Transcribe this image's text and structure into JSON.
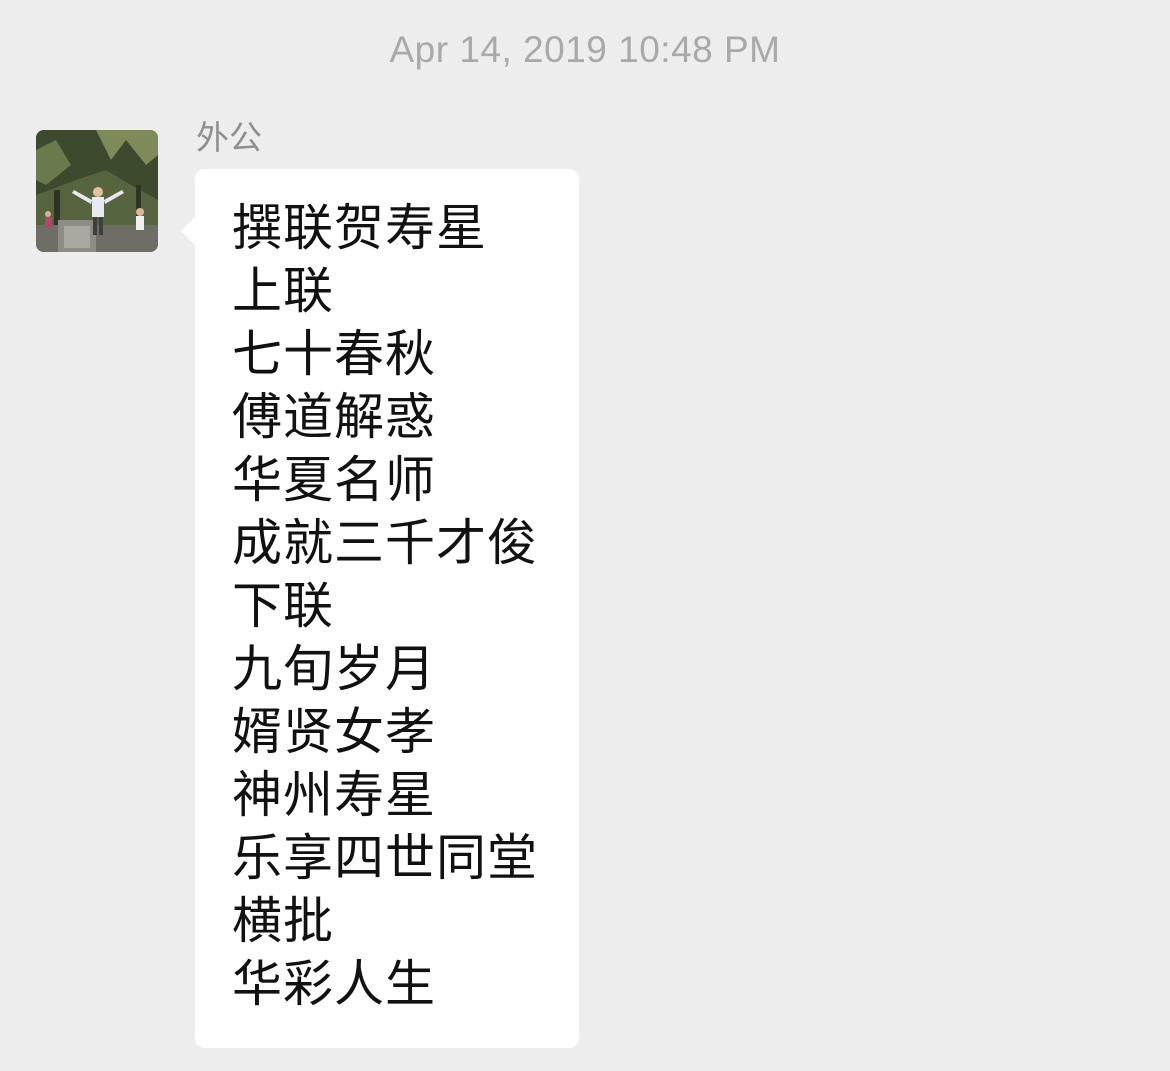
{
  "chat": {
    "timestamp": "Apr 14, 2019 10:48 PM",
    "sender_name": "外公",
    "avatar_icon": "contact-photo-icon",
    "message_lines": [
      "撰联贺寿星",
      "上联",
      "七十春秋",
      "傅道解惑",
      "华夏名师",
      "成就三千才俊",
      "下联",
      "九旬岁月",
      "婿贤女孝",
      "神州寿星",
      "乐享四世同堂",
      "横批",
      "华彩人生"
    ]
  },
  "colors": {
    "background": "#ededed",
    "bubble": "#ffffff",
    "timestamp_text": "#a9a9a9",
    "sender_text": "#8f8f8f",
    "message_text": "#111111"
  }
}
